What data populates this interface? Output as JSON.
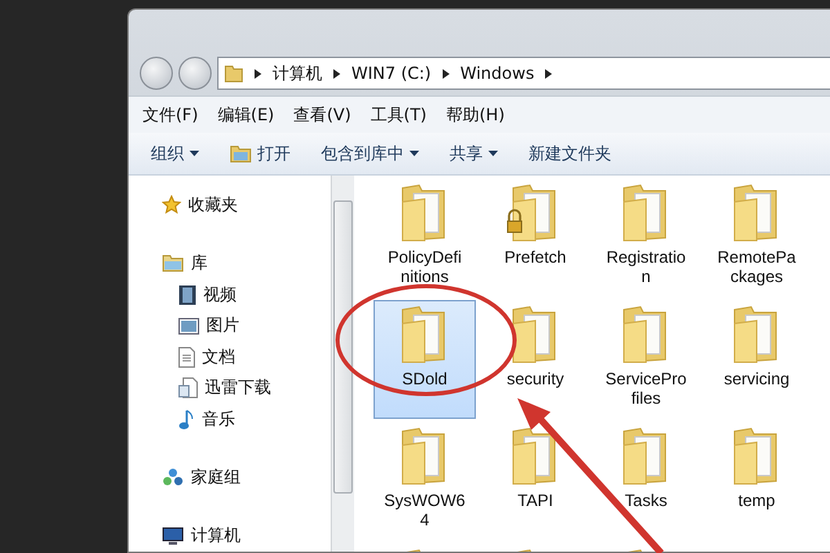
{
  "address_bar": {
    "segments": [
      "计算机",
      "WIN7 (C:)",
      "Windows"
    ]
  },
  "menu_bar": [
    "文件(F)",
    "编辑(E)",
    "查看(V)",
    "工具(T)",
    "帮助(H)"
  ],
  "toolbar": [
    {
      "label": "组织",
      "kind": "dropdown"
    },
    {
      "label": "打开",
      "kind": "open"
    },
    {
      "label": "包含到库中",
      "kind": "dropdown"
    },
    {
      "label": "共享",
      "kind": "dropdown"
    },
    {
      "label": "新建文件夹",
      "kind": "plain"
    }
  ],
  "sidebar": {
    "items": [
      {
        "label": "收藏夹",
        "kind": "favorites"
      },
      {
        "label": "库",
        "kind": "library",
        "children": [
          {
            "label": "视频",
            "kind": "video"
          },
          {
            "label": "图片",
            "kind": "picture"
          },
          {
            "label": "文档",
            "kind": "document"
          },
          {
            "label": "迅雷下载",
            "kind": "download"
          },
          {
            "label": "音乐",
            "kind": "music"
          }
        ]
      },
      {
        "label": "家庭组",
        "kind": "homegroup"
      },
      {
        "label": "计算机",
        "kind": "computer"
      }
    ]
  },
  "folders": [
    {
      "name": "PolicyDefinitions",
      "selected": false,
      "locked": false
    },
    {
      "name": "Prefetch",
      "selected": false,
      "locked": true
    },
    {
      "name": "Registration",
      "selected": false,
      "locked": false
    },
    {
      "name": "RemotePackages",
      "selected": false,
      "locked": false
    },
    {
      "name": "SDold",
      "selected": true,
      "locked": false
    },
    {
      "name": "security",
      "selected": false,
      "locked": false
    },
    {
      "name": "ServiceProfiles",
      "selected": false,
      "locked": false
    },
    {
      "name": "servicing",
      "selected": false,
      "locked": false
    },
    {
      "name": "SysWOW64",
      "selected": false,
      "locked": false
    },
    {
      "name": "TAPI",
      "selected": false,
      "locked": false
    },
    {
      "name": "Tasks",
      "selected": false,
      "locked": false
    },
    {
      "name": "temp",
      "selected": false,
      "locked": false
    }
  ]
}
